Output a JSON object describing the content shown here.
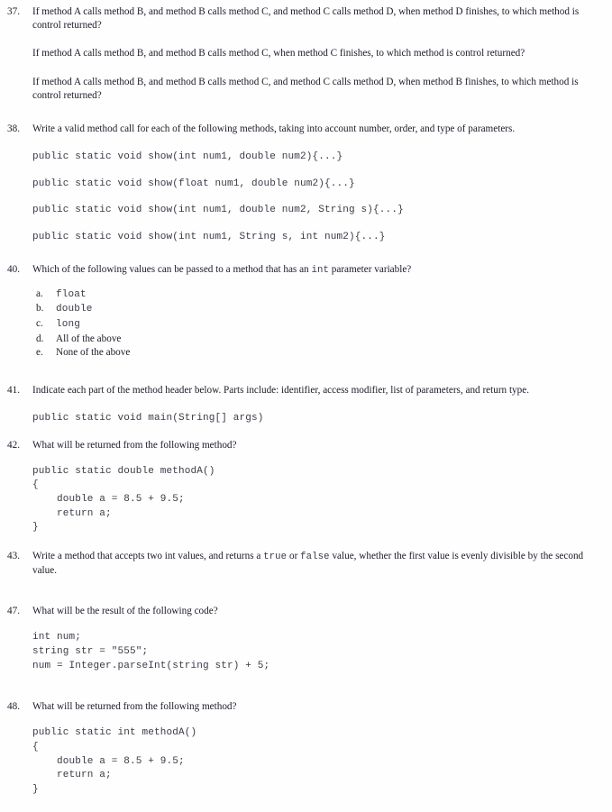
{
  "document": {
    "kind": "worksheet-page",
    "subject_code_language": "Java"
  },
  "questions": [
    {
      "number": "37.",
      "paragraphs": [
        "If method A calls method B, and method B calls method C, and method C calls method D, when method D finishes, to which method is control returned?",
        "If method A calls method B, and method B calls method C, when method C finishes, to which method is control returned?",
        "If method A calls method B, and method B calls method C, and method C calls method D, when method B finishes, to which method is control returned?"
      ]
    },
    {
      "number": "38.",
      "prompt": "Write a valid method call for each of the following methods, taking into account number, order, and type of parameters.",
      "code_lines": [
        "public static void show(int num1, double num2){...}",
        "public static void show(float num1, double num2){...}",
        "public static void show(int num1, double num2, String s){...}",
        "public static void show(int num1, String s, int num2){...}"
      ]
    },
    {
      "number": "40.",
      "prompt_before": "Which of the following values can be passed to a method that has an ",
      "prompt_code": "int",
      "prompt_after": " parameter variable?",
      "options": [
        {
          "letter": "a.",
          "text": "float",
          "mono": true
        },
        {
          "letter": "b.",
          "text": "double",
          "mono": true
        },
        {
          "letter": "c.",
          "text": "long",
          "mono": true
        },
        {
          "letter": "d.",
          "text": "All of the above",
          "mono": false
        },
        {
          "letter": "e.",
          "text": "None of the above",
          "mono": false
        }
      ]
    },
    {
      "number": "41.",
      "prompt": "Indicate each part of the method header below.  Parts include: identifier, access modifier, list of parameters, and return type.",
      "code": "public static void main(String[] args)"
    },
    {
      "number": "42.",
      "prompt": "What will be returned from the following method?",
      "code": "public static double methodA()\n{\n    double a = 8.5 + 9.5;\n    return a;\n}"
    },
    {
      "number": "43.",
      "text_before": "Write a method that accepts two int values, and returns a ",
      "code_true": "true",
      "text_middle": " or ",
      "code_false": "false",
      "text_after": " value, whether the first value is evenly divisible by the second value."
    },
    {
      "number": "47.",
      "prompt": "What will be the result of the following code?",
      "code": "int num;\nstring str = \"555\";\nnum = Integer.parseInt(string str) + 5;"
    },
    {
      "number": "48.",
      "prompt": "What will be returned from the following method?",
      "code": "public static int methodA()\n{\n    double a = 8.5 + 9.5;\n    return a;\n}"
    }
  ]
}
